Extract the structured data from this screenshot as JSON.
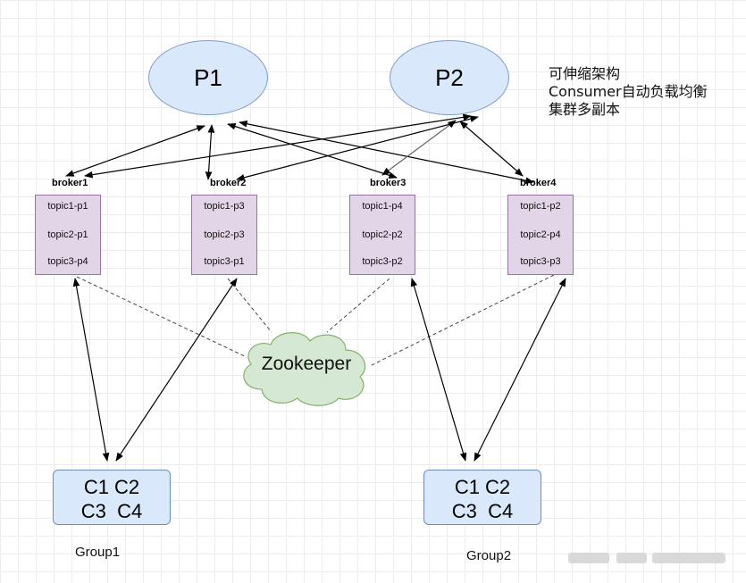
{
  "producers": [
    {
      "id": "p1",
      "label": "P1"
    },
    {
      "id": "p2",
      "label": "P2"
    }
  ],
  "notes": [
    "可伸缩架构",
    "Consumer自动负载均衡",
    "集群多副本"
  ],
  "brokers": [
    {
      "label": "broker1",
      "partitions": [
        "topic1-p1",
        "topic2-p1",
        "topic3-p4"
      ]
    },
    {
      "label": "broker2",
      "partitions": [
        "topic1-p3",
        "topic2-p3",
        "topic3-p1"
      ]
    },
    {
      "label": "broker3",
      "partitions": [
        "topic1-p4",
        "topic2-p2",
        "topic3-p2"
      ]
    },
    {
      "label": "broker4",
      "partitions": [
        "topic1-p2",
        "topic2-p4",
        "topic3-p3"
      ]
    }
  ],
  "zookeeper": {
    "label": "Zookeeper"
  },
  "groups": [
    {
      "label": "Group1",
      "consumers_row1": "C1 C2",
      "consumers_row2": "C3  C4"
    },
    {
      "label": "Group2",
      "consumers_row1": "C1 C2",
      "consumers_row2": "C3  C4"
    }
  ],
  "colors": {
    "producer_fill": "#dae8fc",
    "broker_fill": "#e1d5e7",
    "broker_stroke": "#9673a6",
    "zookeeper_fill": "#d5e8d4",
    "zookeeper_stroke": "#82b366",
    "group_fill": "#dae8fc",
    "group_stroke": "#6c8ebf",
    "edge": "#000000"
  }
}
